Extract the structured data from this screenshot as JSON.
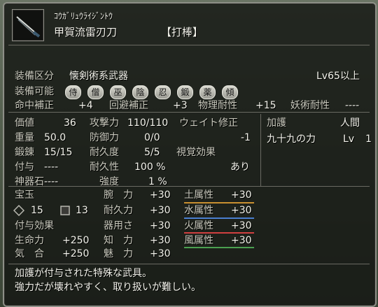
{
  "item": {
    "kana": "ｺｳｶﾞﾘｭｳﾗｲｼﾞﾝﾄｳ",
    "name": "甲賀流雷刃刀",
    "category_tag": "【打棒】",
    "icon": "sword-icon"
  },
  "equip": {
    "class_label": "装備区分",
    "class_value": "懐剣術系武器",
    "level": "Lv65以上",
    "possible_label": "装備可能",
    "classes": [
      "侍",
      "僧",
      "巫",
      "陰",
      "忍",
      "鍛",
      "薬",
      "傾"
    ]
  },
  "mods": [
    {
      "label": "命中補正",
      "value": "+4"
    },
    {
      "label": "回避補正",
      "value": "+3"
    },
    {
      "label": "物理耐性",
      "value": "+15"
    },
    {
      "label": "妖術耐性",
      "value": "----"
    }
  ],
  "stats": {
    "price_label": "価値",
    "price": "36",
    "weight_label": "重量",
    "weight": "50.0",
    "forge_label": "鍛錬",
    "forge": "15/15",
    "enchant_label": "付与",
    "enchant": "----",
    "jinki_label": "神器石",
    "jinki": "----",
    "attack_label": "攻撃力",
    "attack": "110/110",
    "defense_label": "防御力",
    "defense": "0/0",
    "dur_label": "耐久度",
    "dur": "5/5",
    "durrate_label": "耐久性",
    "durrate": "100 %",
    "str_label": "強度",
    "str": "1 %",
    "weight_mod_label": "ウェイト修正",
    "weight_mod": "-1",
    "visual_label": "視覚効果",
    "visual": "あり"
  },
  "protection": {
    "title": "加護",
    "race": "人間",
    "name": "九十九の力",
    "lv_label": "Lv",
    "lv": "1"
  },
  "gems": {
    "label": "宝玉",
    "count1": "15",
    "count2": "13",
    "enchant_effect_label": "付与効果",
    "life_label": "生命力",
    "life": "+250",
    "ki_label": "気　合",
    "ki": "+250"
  },
  "attributes": [
    {
      "label": "腕　力",
      "value": "+30"
    },
    {
      "label": "耐久力",
      "value": "+30"
    },
    {
      "label": "器用さ",
      "value": "+30"
    },
    {
      "label": "知　力",
      "value": "+30"
    },
    {
      "label": "魅　力",
      "value": "+30"
    }
  ],
  "elements": [
    {
      "label": "土属性",
      "value": "+30",
      "color": "#c89030"
    },
    {
      "label": "水属性",
      "value": "+30",
      "color": "#4a7fd0"
    },
    {
      "label": "火属性",
      "value": "+30",
      "color": "#d04040"
    },
    {
      "label": "風属性",
      "value": "+30",
      "color": "#4aa050"
    }
  ],
  "description": [
    "加護が付与された特殊な武具。",
    "強力だが壊れやすく、取り扱いが難しい。"
  ]
}
